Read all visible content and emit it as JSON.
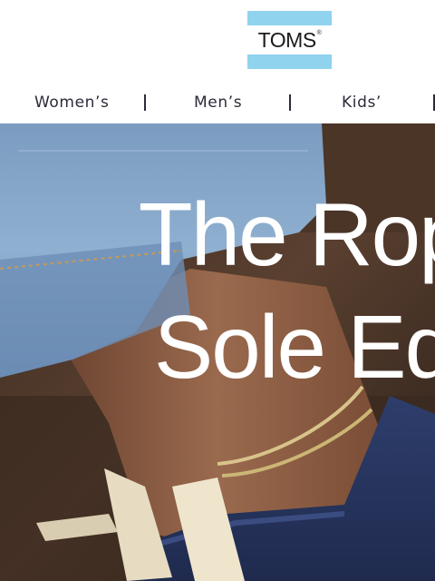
{
  "brand": {
    "name": "TOMS",
    "mark": "®",
    "colors": {
      "band": "#8fd3ee",
      "text": "#1b1b1b"
    }
  },
  "nav": {
    "items": [
      {
        "label": "Women’s"
      },
      {
        "label": "Men’s"
      },
      {
        "label": "Kids’"
      }
    ],
    "separator": "|"
  },
  "hero": {
    "title_line1": "The Rope",
    "title_line2": "Sole Edit",
    "text_color": "#ffffff"
  }
}
